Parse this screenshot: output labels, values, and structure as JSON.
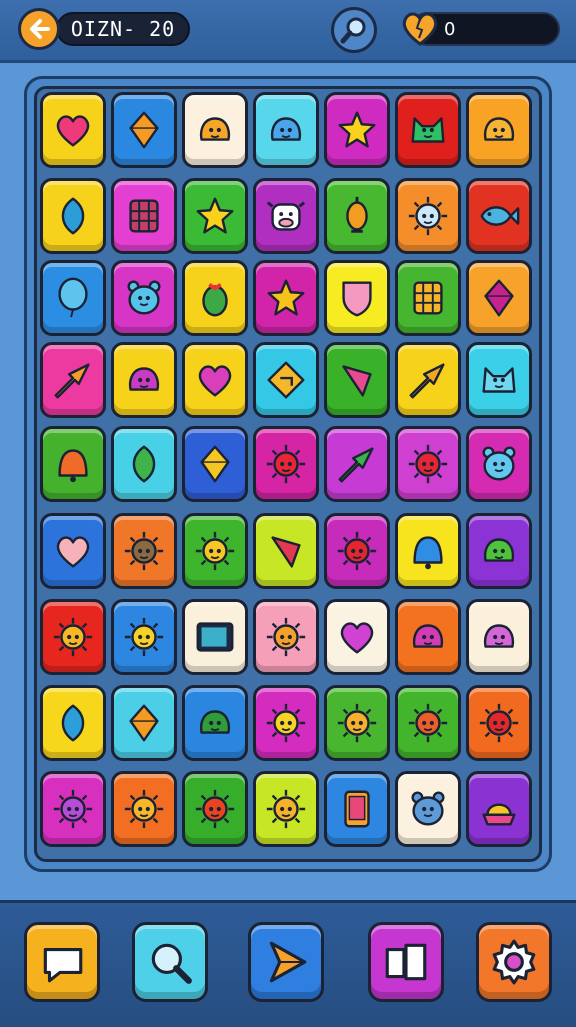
{
  "header": {
    "title_text": "OIZN- 20",
    "lives_text": "0",
    "colors": {
      "back": "#f5a12a",
      "bar": "#2f5f9c"
    }
  },
  "board": {
    "rows": [
      [
        {
          "bg": "#f7d21a",
          "icon": "heart",
          "fg": "#ef3a7a"
        },
        {
          "bg": "#2b88e0",
          "icon": "gem",
          "fg": "#f59a22"
        },
        {
          "bg": "#fbf1de",
          "icon": "blob",
          "fg": "#f6a72a"
        },
        {
          "bg": "#58d6ec",
          "icon": "blob",
          "fg": "#4aa6e8"
        },
        {
          "bg": "#cf2bc0",
          "icon": "star",
          "fg": "#f8d21c"
        },
        {
          "bg": "#e0201c",
          "icon": "cat",
          "fg": "#2fbf65"
        },
        {
          "bg": "#f8a324",
          "icon": "blob",
          "fg": "#f7b336"
        }
      ],
      [
        {
          "bg": "#f7d21a",
          "icon": "leaf",
          "fg": "#2b9ed8"
        },
        {
          "bg": "#e33fd0",
          "icon": "grid",
          "fg": "#c0406a"
        },
        {
          "bg": "#3bba35",
          "icon": "star",
          "fg": "#f8d21c"
        },
        {
          "bg": "#b12fc0",
          "icon": "cow",
          "fg": "#ffffff"
        },
        {
          "bg": "#47b82f",
          "icon": "lamp",
          "fg": "#f39c22"
        },
        {
          "bg": "#f58e2a",
          "icon": "sun",
          "fg": "#cce8f8"
        },
        {
          "bg": "#e23322",
          "icon": "fish",
          "fg": "#4ab3e0"
        }
      ],
      [
        {
          "bg": "#2b8ee2",
          "icon": "balloon",
          "fg": "#5ec4ee"
        },
        {
          "bg": "#d735c6",
          "icon": "bear",
          "fg": "#55c3ea"
        },
        {
          "bg": "#f7d21a",
          "icon": "berry",
          "fg": "#3da846"
        },
        {
          "bg": "#d124a9",
          "icon": "star",
          "fg": "#f8c21c"
        },
        {
          "bg": "#f7ec22",
          "icon": "shield",
          "fg": "#f49ac0"
        },
        {
          "bg": "#46b52f",
          "icon": "grid",
          "fg": "#f5b42a"
        },
        {
          "bg": "#f6a22b",
          "icon": "gem",
          "fg": "#c8228f"
        }
      ],
      [
        {
          "bg": "#ec3aa0",
          "icon": "arrow",
          "fg": "#f59d2a"
        },
        {
          "bg": "#f7d21a",
          "icon": "blob",
          "fg": "#c83cc0"
        },
        {
          "bg": "#f7d21a",
          "icon": "heart",
          "fg": "#d83fb8"
        },
        {
          "bg": "#34c8e6",
          "icon": "sign",
          "fg": "#f6b82a"
        },
        {
          "bg": "#39b22a",
          "icon": "kite",
          "fg": "#e84a90"
        },
        {
          "bg": "#f7d21a",
          "icon": "arrow",
          "fg": "#f3a624"
        },
        {
          "bg": "#3bcfe8",
          "icon": "cat",
          "fg": "#6fd7f0"
        }
      ],
      [
        {
          "bg": "#44b22c",
          "icon": "bell",
          "fg": "#f06a2a"
        },
        {
          "bg": "#48d1e6",
          "icon": "leaf",
          "fg": "#3fb34a"
        },
        {
          "bg": "#2e5fd6",
          "icon": "gem",
          "fg": "#f6c622"
        },
        {
          "bg": "#d524a4",
          "icon": "sun",
          "fg": "#e82634"
        },
        {
          "bg": "#c63bd4",
          "icon": "arrow",
          "fg": "#3bb34a"
        },
        {
          "bg": "#cf3fd0",
          "icon": "sun",
          "fg": "#e62535"
        },
        {
          "bg": "#d52bb2",
          "icon": "bear",
          "fg": "#62c8ee"
        }
      ],
      [
        {
          "bg": "#2d73dc",
          "icon": "heart",
          "fg": "#f5b2b8"
        },
        {
          "bg": "#f0762a",
          "icon": "sun",
          "fg": "#8a6a42"
        },
        {
          "bg": "#3eb52d",
          "icon": "sun",
          "fg": "#f7c825"
        },
        {
          "bg": "#c7e626",
          "icon": "kite",
          "fg": "#e23a52"
        },
        {
          "bg": "#c62bba",
          "icon": "sun",
          "fg": "#e22730"
        },
        {
          "bg": "#f7e41e",
          "icon": "bell",
          "fg": "#2f8ee3"
        },
        {
          "bg": "#8c33d6",
          "icon": "blob",
          "fg": "#4dc23a"
        }
      ],
      [
        {
          "bg": "#e6261f",
          "icon": "sun",
          "fg": "#f8b825"
        },
        {
          "bg": "#2d86e0",
          "icon": "sun",
          "fg": "#f7d224"
        },
        {
          "bg": "#fbf0dc",
          "icon": "screen",
          "fg": "#3bb0c8"
        },
        {
          "bg": "#f69fb8",
          "icon": "sun",
          "fg": "#f5a02a"
        },
        {
          "bg": "#fbf3e2",
          "icon": "heart",
          "fg": "#d242d2"
        },
        {
          "bg": "#f3721f",
          "icon": "blob",
          "fg": "#d33cb2"
        },
        {
          "bg": "#fbf0dc",
          "icon": "blob",
          "fg": "#d566d8"
        }
      ],
      [
        {
          "bg": "#f7d71c",
          "icon": "leaf",
          "fg": "#2c9ed8"
        },
        {
          "bg": "#4ccfe6",
          "icon": "gem",
          "fg": "#f59a22"
        },
        {
          "bg": "#2b86df",
          "icon": "blob",
          "fg": "#2f9e3a"
        },
        {
          "bg": "#d32cbf",
          "icon": "sun",
          "fg": "#f8d224"
        },
        {
          "bg": "#48b62f",
          "icon": "sun",
          "fg": "#f6b12b"
        },
        {
          "bg": "#43b52c",
          "icon": "sun",
          "fg": "#ee5e2a"
        },
        {
          "bg": "#f26a1f",
          "icon": "sun",
          "fg": "#e2282a"
        }
      ],
      [
        {
          "bg": "#d830be",
          "icon": "sun",
          "fg": "#b64dd8"
        },
        {
          "bg": "#f26e22",
          "icon": "sun",
          "fg": "#f6b72b"
        },
        {
          "bg": "#36ae2c",
          "icon": "sun",
          "fg": "#e8441f"
        },
        {
          "bg": "#c7e626",
          "icon": "sun",
          "fg": "#f6b22b"
        },
        {
          "bg": "#2d86e0",
          "icon": "phone",
          "fg": "#f6a22a"
        },
        {
          "bg": "#fbf1de",
          "icon": "bear",
          "fg": "#5d9ad8"
        },
        {
          "bg": "#8a33d2",
          "icon": "cake",
          "fg": "#f6c52a"
        }
      ]
    ]
  },
  "toolbar": {
    "buttons": [
      {
        "name": "chat-button",
        "icon": "chat",
        "bg": "#f6b11f"
      },
      {
        "name": "search-button",
        "icon": "search",
        "bg": "#4ed0e8"
      },
      {
        "name": "play-button",
        "icon": "play",
        "bg": "#2e7fe0"
      },
      {
        "name": "cards-button",
        "icon": "cards",
        "bg": "#c637d2"
      },
      {
        "name": "settings-button",
        "icon": "gear",
        "bg": "#f3772a"
      }
    ]
  }
}
